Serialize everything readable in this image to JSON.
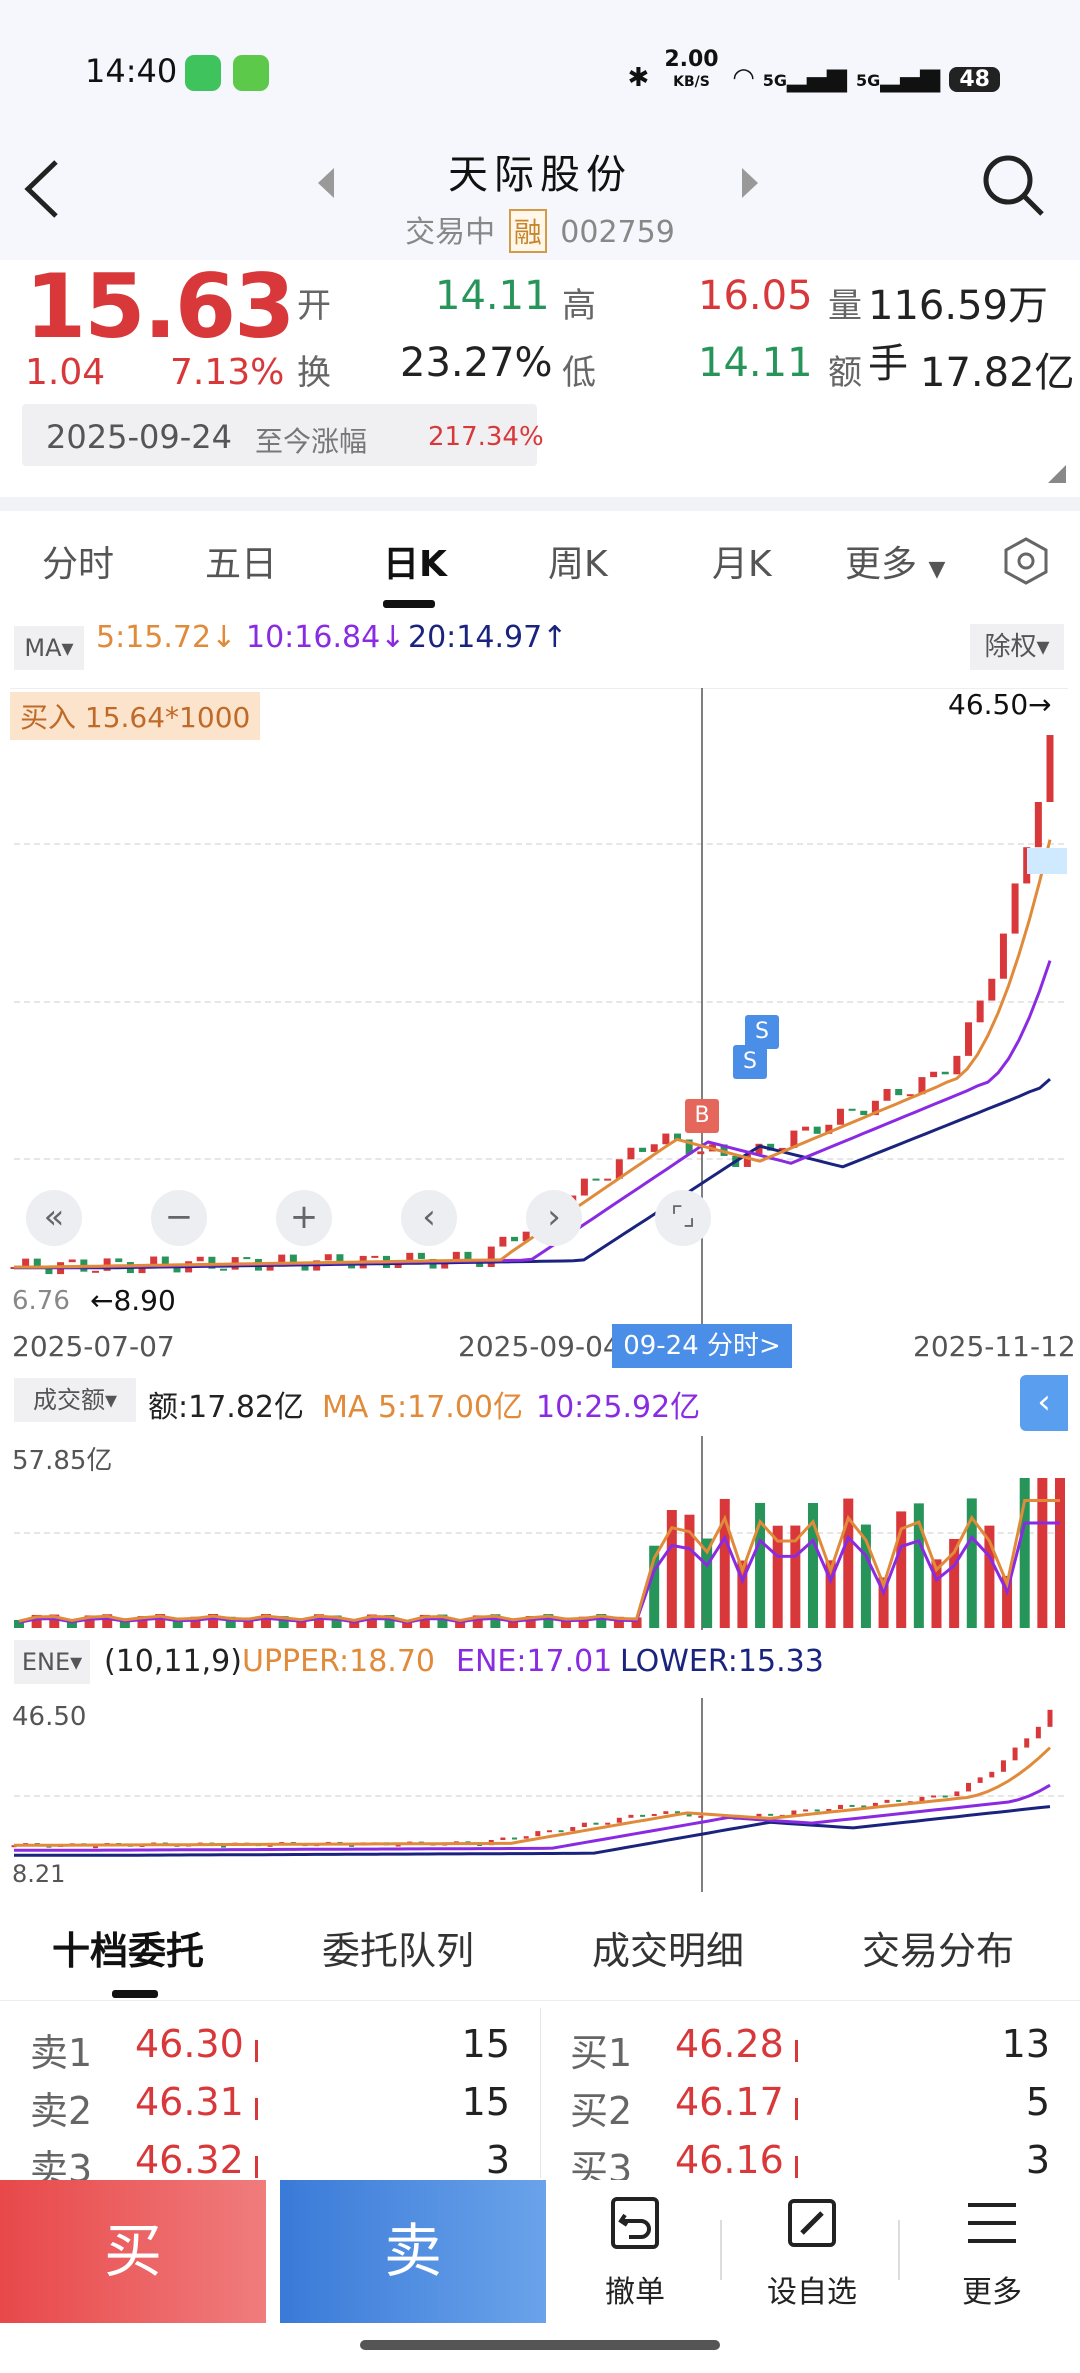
{
  "status_bar": {
    "time": "14:40",
    "net_speed": "2.00",
    "net_unit": "KB/S",
    "signal1": "5G",
    "signal2": "5G",
    "battery": "48"
  },
  "header": {
    "title": "天际股份",
    "status": "交易中",
    "badge": "融",
    "code": "002759"
  },
  "quote": {
    "price": "15.63",
    "change": "1.04",
    "change_pct": "7.13%",
    "open_label": "开",
    "open": "14.11",
    "high_label": "高",
    "high": "16.05",
    "volume_label": "量",
    "volume": "116.59万手",
    "turnover_label": "换",
    "turnover": "23.27%",
    "low_label": "低",
    "low": "14.11",
    "amount_label": "额",
    "amount": "17.82亿",
    "date": "2025-09-24",
    "since_label": "至今涨幅",
    "since_value": "217.34%"
  },
  "tabs": [
    "分时",
    "五日",
    "日K",
    "周K",
    "月K",
    "更多"
  ],
  "kline": {
    "ma_button": "MA",
    "ma5": "5:15.72↓",
    "ma10": "10:16.84↓",
    "ma20": "20:14.97↑",
    "adjust": "除权",
    "buy_tag": "买入 15.64*1000",
    "max_label": "46.50→",
    "min_left": "6.76",
    "min_label": "←8.90",
    "date_start": "2025-07-07",
    "date_mid": "2025-09-04",
    "date_end": "2025-11-12",
    "crosshair_label": "09-24 分时>",
    "marker_b": "B",
    "marker_s": "S",
    "colors": {
      "up": "#d8383a",
      "down": "#27955a",
      "ma5": "#e08a3a",
      "ma10": "#8a2be2",
      "ma20": "#1a237e"
    }
  },
  "volume_panel": {
    "selector": "成交额",
    "amount": "额:17.82亿",
    "ma5": "MA 5:17.00亿",
    "ma10": "10:25.92亿",
    "max_label": "57.85亿"
  },
  "ene_panel": {
    "selector": "ENE",
    "params": "(10,11,9)",
    "upper": "UPPER:18.70",
    "ene": "ENE:17.01",
    "lower": "LOWER:15.33",
    "max_label": "46.50",
    "min_label": "8.21"
  },
  "book_tabs": [
    "十档委托",
    "委托队列",
    "成交明细",
    "交易分布"
  ],
  "order_book": {
    "sell": [
      {
        "label": "卖1",
        "price": "46.30",
        "vol": "15"
      },
      {
        "label": "卖2",
        "price": "46.31",
        "vol": "15"
      },
      {
        "label": "卖3",
        "price": "46.32",
        "vol": "3"
      }
    ],
    "buy": [
      {
        "label": "买1",
        "price": "46.28",
        "vol": "13"
      },
      {
        "label": "买2",
        "price": "46.17",
        "vol": "5"
      },
      {
        "label": "买3",
        "price": "46.16",
        "vol": "3"
      }
    ]
  },
  "bottom": {
    "buy": "买",
    "sell": "卖",
    "cancel": "撤单",
    "watch": "设自选",
    "more": "更多"
  }
}
